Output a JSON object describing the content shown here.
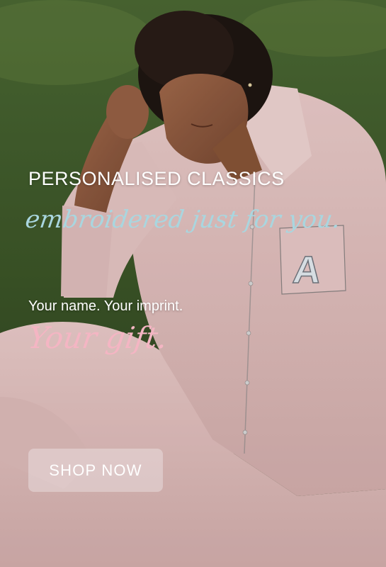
{
  "hero": {
    "heading": "PERSONALISED CLASSICS",
    "script_line": "embroidered just for you.",
    "tagline": "Your name. Your imprint.",
    "script_gift": "Your gift.",
    "cta_label": "SHOP NOW",
    "monogram_letter": "A"
  },
  "colors": {
    "heading": "#ffffff",
    "script_line": "#a9d6df",
    "script_gift": "#f4b5c3",
    "button_bg": "rgba(240,234,236,0.42)",
    "pajama": "#e9c9c6",
    "grass": "#3e5a2a"
  }
}
